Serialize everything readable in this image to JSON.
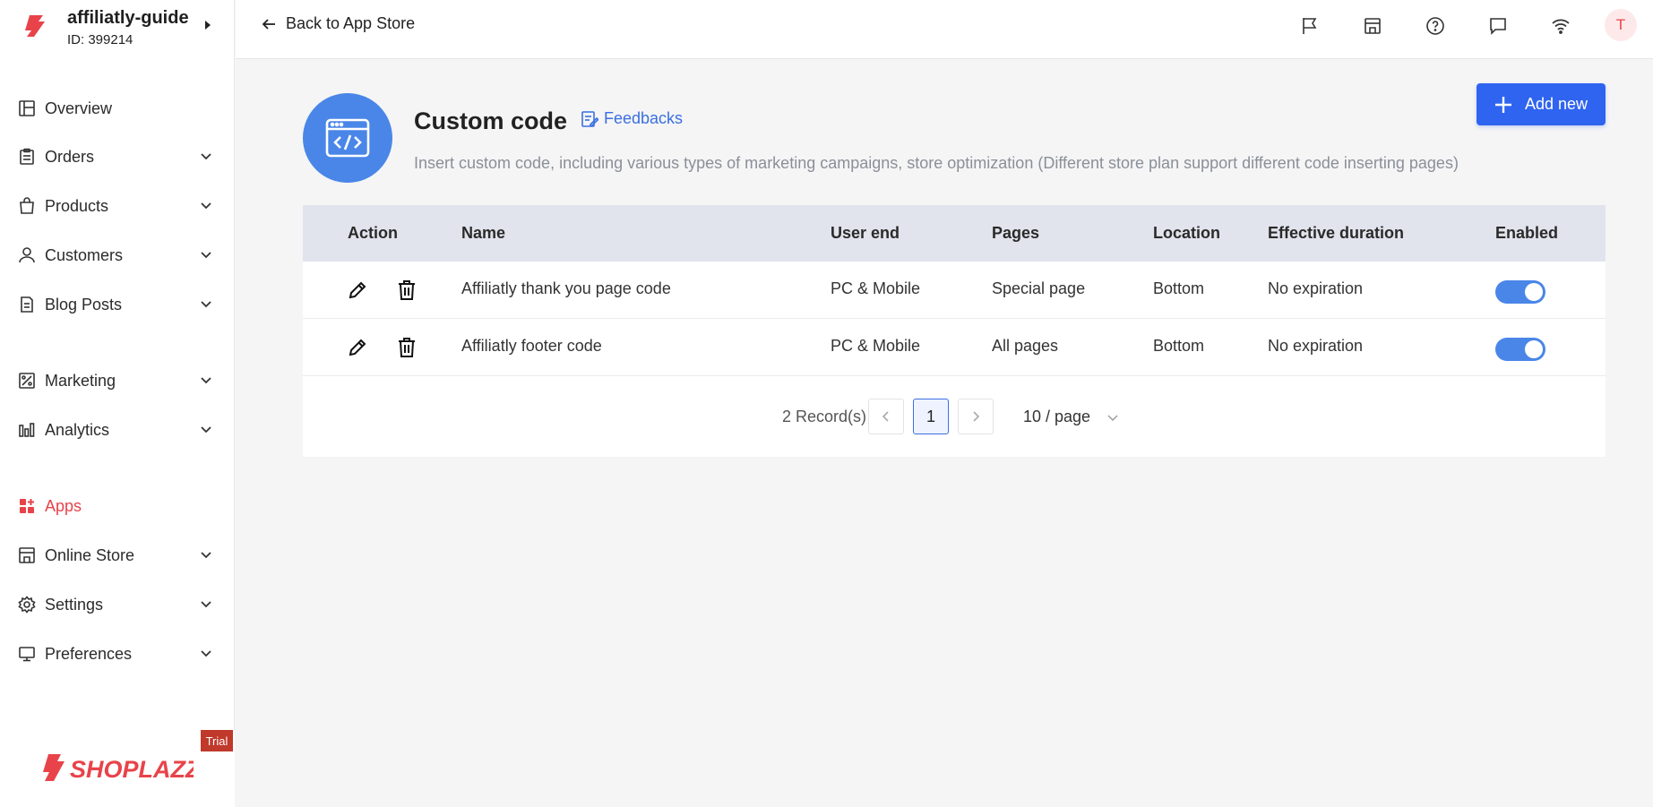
{
  "store": {
    "name": "affiliatly-guide",
    "id_text": "ID: 399214"
  },
  "sidebar": {
    "items": [
      {
        "label": "Overview",
        "icon": "layout-icon",
        "has_chevron": false
      },
      {
        "label": "Orders",
        "icon": "clipboard-icon",
        "has_chevron": true
      },
      {
        "label": "Products",
        "icon": "bag-icon",
        "has_chevron": true
      },
      {
        "label": "Customers",
        "icon": "user-icon",
        "has_chevron": true
      },
      {
        "label": "Blog Posts",
        "icon": "document-icon",
        "has_chevron": true
      },
      {
        "label": "Marketing",
        "icon": "marketing-icon",
        "has_chevron": true
      },
      {
        "label": "Analytics",
        "icon": "bar-chart-icon",
        "has_chevron": true
      },
      {
        "label": "Apps",
        "icon": "apps-icon",
        "has_chevron": false,
        "active": true
      },
      {
        "label": "Online Store",
        "icon": "storefront-icon",
        "has_chevron": true
      },
      {
        "label": "Settings",
        "icon": "gear-icon",
        "has_chevron": true
      },
      {
        "label": "Preferences",
        "icon": "monitor-icon",
        "has_chevron": true
      }
    ],
    "trial_badge": "Trial",
    "brand": "SHOPLAZZA"
  },
  "topbar": {
    "back_label": "Back to App Store",
    "icons": [
      "flag-icon",
      "store-icon",
      "help-icon",
      "chat-icon",
      "wifi-icon"
    ],
    "avatar_initial": "T"
  },
  "page": {
    "title": "Custom code",
    "feedbacks_label": "Feedbacks",
    "description": "Insert custom code, including various types of marketing campaigns, store optimization (Different store plan support different code inserting pages)",
    "add_button_label": "Add new"
  },
  "table": {
    "columns": [
      "Action",
      "Name",
      "User end",
      "Pages",
      "Location",
      "Effective duration",
      "Enabled"
    ],
    "rows": [
      {
        "name": "Affiliatly thank you page code",
        "user_end": "PC & Mobile",
        "pages": "Special page",
        "location": "Bottom",
        "duration": "No expiration",
        "enabled": true
      },
      {
        "name": "Affiliatly footer code",
        "user_end": "PC & Mobile",
        "pages": "All pages",
        "location": "Bottom",
        "duration": "No expiration",
        "enabled": true
      }
    ]
  },
  "pagination": {
    "records": "2 Record(s)",
    "current_page": "1",
    "per_page": "10 / page"
  },
  "colors": {
    "accent": "#2f64f0",
    "active_nav": "#e8434a",
    "toggle_on": "#4a86e8",
    "header_bg": "#e1e4ec"
  }
}
